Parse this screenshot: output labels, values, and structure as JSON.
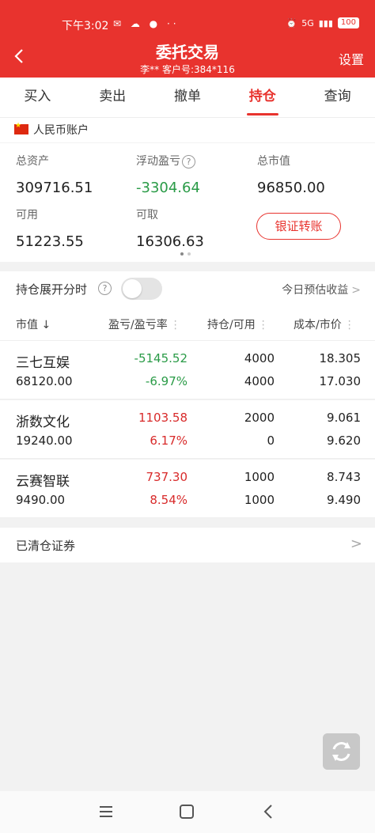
{
  "status_bar": {
    "time": "下午3:02",
    "network": "5G",
    "battery": "100"
  },
  "header": {
    "title": "委托交易",
    "subtitle": "李**  客户号:384*116",
    "settings": "设置"
  },
  "tabs": [
    {
      "label": "买入"
    },
    {
      "label": "卖出"
    },
    {
      "label": "撤单"
    },
    {
      "label": "持仓"
    },
    {
      "label": "查询"
    }
  ],
  "account": {
    "label": "人民币账户"
  },
  "assets": {
    "total_label": "总资产",
    "total_value": "309716.51",
    "pnl_label": "浮动盈亏",
    "pnl_value": "-3304.64",
    "mv_label": "总市值",
    "mv_value": "96850.00",
    "available_label": "可用",
    "available_value": "51223.55",
    "withdrawable_label": "可取",
    "withdrawable_value": "16306.63",
    "transfer_button": "银证转账"
  },
  "toggle": {
    "label": "持仓展开分时",
    "estimate": "今日预估收益"
  },
  "columns": {
    "c1": "市值",
    "c1_sort": "↓",
    "c2": "盈亏/盈亏率",
    "c3": "持仓/可用",
    "c4": "成本/市价"
  },
  "holdings": [
    {
      "name": "三七互娱",
      "market_value": "68120.00",
      "pnl": "-5145.52",
      "pnl_rate": "-6.97%",
      "position": "4000",
      "available": "4000",
      "cost": "18.305",
      "price": "17.030"
    },
    {
      "name": "浙数文化",
      "market_value": "19240.00",
      "pnl": "1103.58",
      "pnl_rate": "6.17%",
      "position": "2000",
      "available": "0",
      "cost": "9.061",
      "price": "9.620"
    },
    {
      "name": "云赛智联",
      "market_value": "9490.00",
      "pnl": "737.30",
      "pnl_rate": "8.54%",
      "position": "1000",
      "available": "1000",
      "cost": "8.743",
      "price": "9.490"
    }
  ],
  "cleared": {
    "label": "已清仓证券"
  },
  "colors": {
    "brand": "#e8332e",
    "gain": "#d82a2a",
    "loss": "#2a9b47"
  }
}
